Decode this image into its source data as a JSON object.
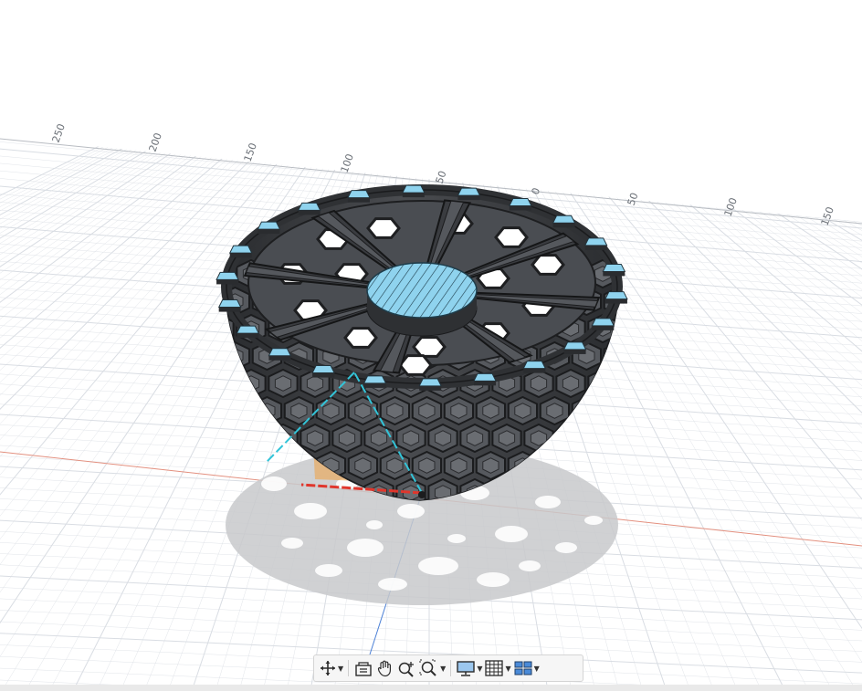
{
  "viewport": {
    "background": "#ffffff",
    "grid_color": "#d9dde3",
    "x_axis_color": "#e07f6c",
    "z_axis_color": "#4a7fd6",
    "model_color": "#3b3d40",
    "section_face_color": "#8fd3ee",
    "selection_color": "#f0a040",
    "ruler_labels": [
      "250",
      "200",
      "150",
      "100",
      "50",
      "0",
      "50",
      "100",
      "150"
    ]
  },
  "navigation_toolbar": {
    "items": [
      {
        "icon": "orbit-icon",
        "has_dropdown": true
      },
      {
        "icon": "look-at-icon",
        "has_dropdown": false
      },
      {
        "icon": "pan-hand-icon",
        "has_dropdown": false
      },
      {
        "icon": "zoom-icon",
        "has_dropdown": false
      },
      {
        "icon": "fit-window-icon",
        "has_dropdown": true
      },
      {
        "icon": "display-settings-icon",
        "has_dropdown": true
      },
      {
        "icon": "grid-snaps-icon",
        "has_dropdown": true
      },
      {
        "icon": "viewports-icon",
        "has_dropdown": true
      }
    ]
  }
}
